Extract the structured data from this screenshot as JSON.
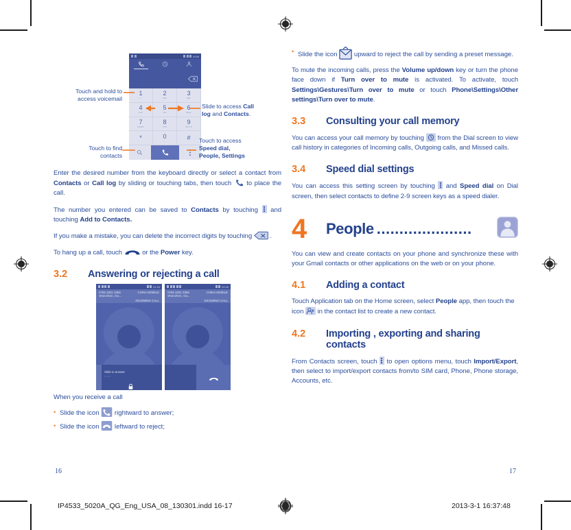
{
  "document": {
    "left_page_number": "16",
    "right_page_number": "17",
    "footer_file": "IP4533_5020A_QG_Eng_USA_08_130301.indd   16-17",
    "footer_date": "2013-3-1   16:37:48"
  },
  "colors": {
    "heading_blue": "#23418c",
    "body_blue": "#2b4d9b",
    "accent_orange": "#ef7622",
    "phone_ui_blue": "#4b5fa8",
    "keypad_grey": "#dfe2ee"
  },
  "left_page": {
    "dialer": {
      "status_time": "04:58",
      "tabs": [
        {
          "name": "dial-tab",
          "icon": "handset-icon"
        },
        {
          "name": "call-log-tab",
          "icon": "clock-icon"
        },
        {
          "name": "contacts-tab",
          "icon": "person-icon"
        }
      ],
      "input_icon": "backspace-icon",
      "keys": [
        {
          "num": "1",
          "sub": "∞"
        },
        {
          "num": "2",
          "sub": "ABC"
        },
        {
          "num": "3",
          "sub": "DEF"
        },
        {
          "num": "4",
          "sub": "GHI"
        },
        {
          "num": "5",
          "sub": "JKL"
        },
        {
          "num": "6",
          "sub": "MNO"
        },
        {
          "num": "7",
          "sub": "PQRS"
        },
        {
          "num": "8",
          "sub": "TUV"
        },
        {
          "num": "9",
          "sub": "WXYZ"
        },
        {
          "num": "*",
          "sub": ""
        },
        {
          "num": "0",
          "sub": "+"
        },
        {
          "num": "#",
          "sub": ""
        }
      ],
      "bottom": [
        {
          "name": "search-contacts-button",
          "icon": "search-icon"
        },
        {
          "name": "place-call-button",
          "icon": "handset-icon"
        },
        {
          "name": "overflow-menu-button",
          "icon": "three-dots-icon"
        }
      ]
    },
    "callouts": {
      "voicemail": "Touch and hold to\naccess voicemail",
      "voicemail_l1": "Touch and hold to",
      "voicemail_l2": "access voicemail",
      "find_contacts_l1": "Touch to find",
      "find_contacts_l2": "contacts",
      "slide_access_pre": "Slide to access ",
      "slide_access_b1": "Call",
      "slide_access_l2_b": "log",
      "slide_access_l2_mid": " and ",
      "slide_access_l2_b2": "Contacts",
      "slide_access_l2_end": ".",
      "menu_l1": "Touch to access",
      "menu_l2": "Speed dial,",
      "menu_l3": "People, Settings"
    },
    "paragraphs": {
      "p1_a": "Enter the desired number from the keyboard directly or select a contact from ",
      "p1_b1": "Contacts",
      "p1_c": " or ",
      "p1_b2": "Call log",
      "p1_d": " by sliding or touching tabs, then touch ",
      "p1_e": " to place the call.",
      "p2_a": "The number you entered can be saved to ",
      "p2_b1": "Contacts",
      "p2_c": " by touching ",
      "p2_d": " and touching ",
      "p2_b2": "Add to Contacts.",
      "p3_a": "If you make a mistake, you can delete the incorrect digits by touching ",
      "p3_b": " .",
      "p4_a": "To hang up a call, touch ",
      "p4_b": " or the ",
      "p4_b1": "Power",
      "p4_c": " key."
    },
    "section_3_2": {
      "num": "3.2",
      "title": "Answering or rejecting a call"
    },
    "call_screens": [
      {
        "name": "incoming-call-slide-to-answer",
        "status_time": "04:58",
        "number": "0755 3331 3355",
        "location": "Shenzhen, Gu...",
        "carrier": "CHINA MOBILE",
        "state": "INCOMING CALL",
        "hint": "Slide to answer",
        "footer_icon": "lock-icon"
      },
      {
        "name": "incoming-call-reject",
        "status_time": "04:58",
        "number": "0755 3331 3355",
        "location": "Shenzhen, Gu...",
        "carrier": "CHINA MOBILE",
        "state": "INCOMING CALL",
        "hint": "",
        "footer_icon": "hangup-icon"
      }
    ],
    "receive_caption": "When you receive a call",
    "bullets": [
      {
        "pre": "Slide the icon ",
        "icon": "answer-call-icon",
        "post": " rightward to answer;"
      },
      {
        "pre": "Slide the icon ",
        "icon": "reject-call-icon",
        "post": " leftward to reject;"
      }
    ]
  },
  "right_page": {
    "bullet_preset": {
      "pre": "Slide the icon ",
      "icon": "message-icon",
      "post": " upward to reject the call by sending a preset message."
    },
    "paragraphs": {
      "mute_a": "To mute the incoming calls, press the ",
      "mute_b1": "Volume up/down",
      "mute_c": " key or turn the phone face down if ",
      "mute_b2": "Turn over to mute",
      "mute_d": " is activated. To activate, touch ",
      "mute_b3": "Settings\\Gestures\\Turn over to mute",
      "mute_e": " or touch ",
      "mute_b4": "Phone\\Settings\\Other settings\\Turn over to mute",
      "mute_f": "."
    },
    "section_3_3": {
      "num": "3.3",
      "title": "Consulting your call memory",
      "body_a": "You can access your call memory by touching ",
      "body_b": " from the Dial screen to view call history in categories of Incoming calls, Outgoing calls, and Missed calls."
    },
    "section_3_4": {
      "num": "3.4",
      "title": "Speed dial settings",
      "body_a": "You can access this setting screen by touching ",
      "body_b": " and ",
      "body_bold": "Speed dial",
      "body_c": " on Dial screen, then select contacts to define 2-9 screen keys as a speed dialer."
    },
    "chapter_4": {
      "num": "4",
      "title": "People",
      "dots": ".....................",
      "icon": "people-app-icon",
      "intro": "You can view and create contacts on your phone and synchronize these with your Gmail contacts or other applications on the web or on your phone."
    },
    "section_4_1": {
      "num": "4.1",
      "title": "Adding a contact",
      "body_a": "Touch Application tab on the Home screen, select ",
      "body_bold": "People",
      "body_b": " app, then touch the icon ",
      "body_c": " in the contact list to create a new contact."
    },
    "section_4_2": {
      "num": "4.2",
      "title_l1": "Importing , exporting and sharing",
      "title_l2": "contacts",
      "body_a": "From Contacts screen, touch ",
      "body_b": " to open options menu, touch ",
      "body_bold": "Import/Export",
      "body_c": ", then select to import/export contacts from/to SIM card, Phone, Phone storage, Accounts, etc."
    }
  }
}
